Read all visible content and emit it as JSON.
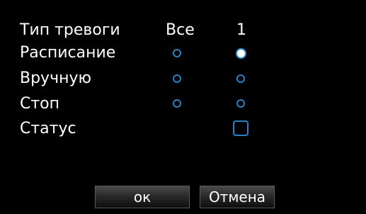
{
  "dialog": {
    "header": {
      "type_label": "Тип тревоги",
      "col_all": "Все",
      "col_1": "1"
    },
    "rows": [
      {
        "label": "Расписание",
        "all_selected": false,
        "ch1_selected": true
      },
      {
        "label": "Вручную",
        "all_selected": false,
        "ch1_selected": false
      },
      {
        "label": "Стоп",
        "all_selected": false,
        "ch1_selected": false
      }
    ],
    "status": {
      "label": "Статус",
      "checked": false
    },
    "buttons": {
      "ok": "ок",
      "cancel": "Отмена"
    }
  },
  "colors": {
    "background": "#000000",
    "accent": "#2c7fc0",
    "text": "#ffffff"
  }
}
